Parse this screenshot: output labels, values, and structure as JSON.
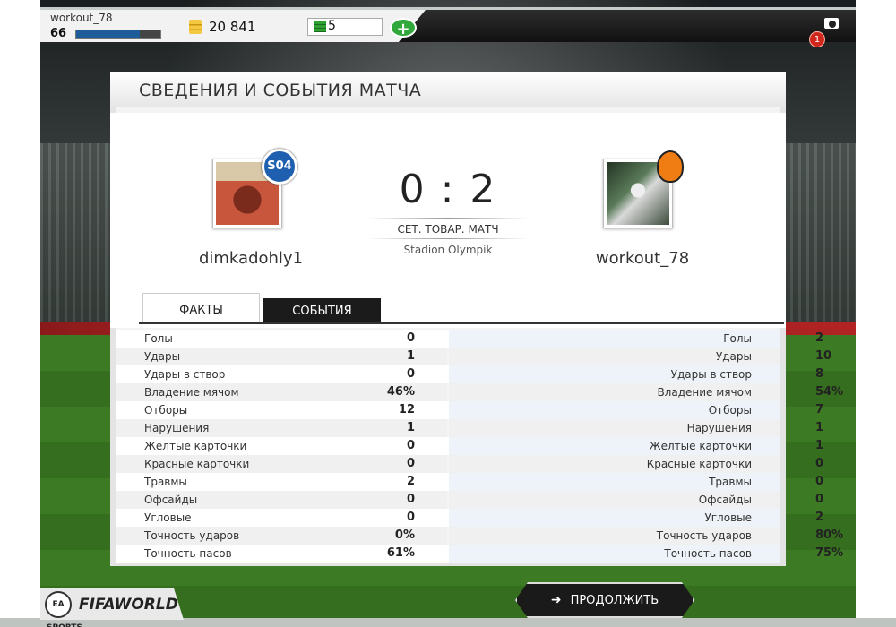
{
  "header": {
    "username": "workout_78",
    "level": "66",
    "xp_progress": 0.75,
    "coins": "20 841",
    "packs": "5",
    "add_label": "+",
    "notification_count": "1"
  },
  "panel": {
    "title": "СВЕДЕНИЯ И СОБЫТИЯ МАТЧА"
  },
  "match": {
    "home_player": "dimkadohly1",
    "away_player": "workout_78",
    "score": "0 : 2",
    "match_type": "СЕТ. ТОВАР. МАТЧ",
    "stadium": "Stadion Olympik",
    "home_badge_text": "S04"
  },
  "tabs": {
    "facts": "ФАКТЫ",
    "events": "СОБЫТИЯ"
  },
  "stats": [
    {
      "label": "Голы",
      "home": "0",
      "away": "2"
    },
    {
      "label": "Удары",
      "home": "1",
      "away": "10"
    },
    {
      "label": "Удары в створ",
      "home": "0",
      "away": "8"
    },
    {
      "label": "Владение мячом",
      "home": "46%",
      "away": "54%"
    },
    {
      "label": "Отборы",
      "home": "12",
      "away": "7"
    },
    {
      "label": "Нарушения",
      "home": "1",
      "away": "1"
    },
    {
      "label": "Желтые карточки",
      "home": "0",
      "away": "1"
    },
    {
      "label": "Красные карточки",
      "home": "0",
      "away": "0"
    },
    {
      "label": "Травмы",
      "home": "2",
      "away": "0"
    },
    {
      "label": "Офсайды",
      "home": "0",
      "away": "0"
    },
    {
      "label": "Угловые",
      "home": "0",
      "away": "2"
    },
    {
      "label": "Точность ударов",
      "home": "0%",
      "away": "80%"
    },
    {
      "label": "Точность пасов",
      "home": "61%",
      "away": "75%"
    }
  ],
  "footer": {
    "ea_logo": "EA SPORTS",
    "fifa_logo": "FIFAWORLD",
    "continue_label": "ПРОДОЛЖИТЬ"
  },
  "icons": {
    "coins": "coins-icon",
    "packs": "packs-icon",
    "camera": "camera-icon",
    "arrow": "arrow-right-icon"
  },
  "colors": {
    "accent_green": "#31a83a",
    "xp_blue": "#1d5c99",
    "notification_red": "#d0261b"
  }
}
